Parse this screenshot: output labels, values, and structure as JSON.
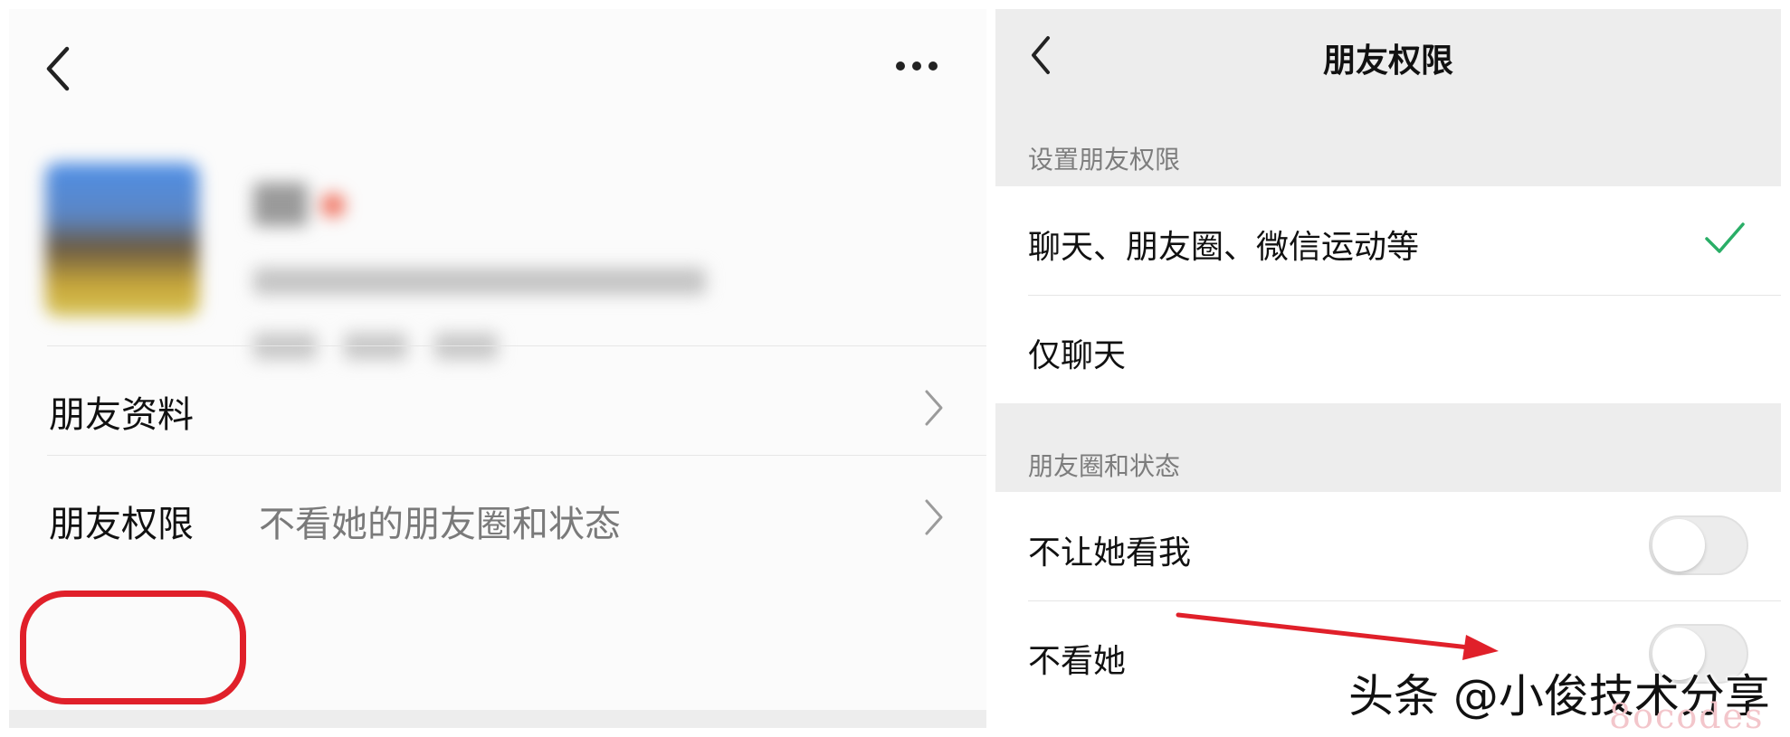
{
  "left_panel": {
    "menu": {
      "profile_label": "朋友资料",
      "permissions_label": "朋友权限",
      "permissions_value": "不看她的朋友圈和状态"
    }
  },
  "right_panel": {
    "title": "朋友权限",
    "sections": [
      {
        "header": "设置朋友权限",
        "items": [
          {
            "label": "聊天、朋友圈、微信运动等",
            "selected": true
          },
          {
            "label": "仅聊天",
            "selected": false
          }
        ]
      },
      {
        "header": "朋友圈和状态",
        "items": [
          {
            "label": "不让她看我",
            "toggle_on": false
          },
          {
            "label": "不看她",
            "toggle_on": false
          }
        ]
      }
    ]
  },
  "watermark": {
    "text": "头条 @小俊技术分享",
    "faint": "8ocodes"
  },
  "colors": {
    "check_green": "#2aae67",
    "annotation_red": "#e0202a",
    "group_bg": "#ededed"
  },
  "icons": {
    "back": "chevron-left-icon",
    "more": "more-dots-icon",
    "row_chevron": "chevron-right-icon",
    "check": "checkmark-icon"
  }
}
